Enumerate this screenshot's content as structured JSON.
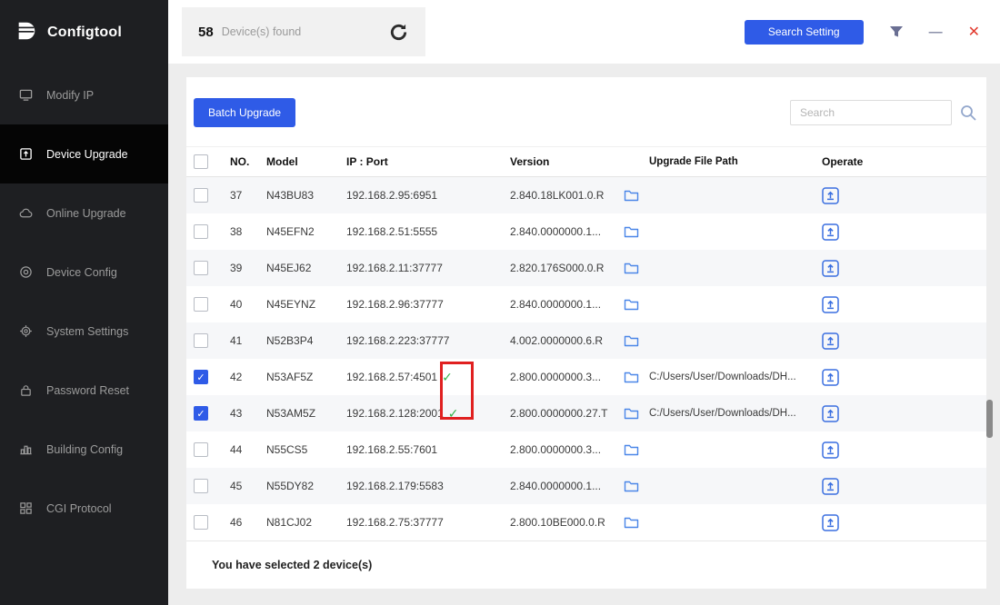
{
  "app": {
    "title": "Configtool"
  },
  "colors": {
    "accent_blue": "#2f5be7",
    "green_check": "#33b54a",
    "annotation_red": "#e02020",
    "close_red": "#e23a2e",
    "sidebar_bg": "#1e1f22"
  },
  "sidebar": {
    "items": [
      {
        "id": "modify-ip",
        "label": "Modify IP",
        "active": false
      },
      {
        "id": "device-upgrade",
        "label": "Device Upgrade",
        "active": true
      },
      {
        "id": "online-upgrade",
        "label": "Online Upgrade",
        "active": false
      },
      {
        "id": "device-config",
        "label": "Device Config",
        "active": false
      },
      {
        "id": "system-settings",
        "label": "System Settings",
        "active": false
      },
      {
        "id": "password-reset",
        "label": "Password Reset",
        "active": false
      },
      {
        "id": "building-config",
        "label": "Building Config",
        "active": false
      },
      {
        "id": "cgi-protocol",
        "label": "CGI Protocol",
        "active": false
      }
    ]
  },
  "header": {
    "device_count": "58",
    "device_count_label": "Device(s) found",
    "search_setting_label": "Search Setting"
  },
  "toolbar": {
    "batch_upgrade_label": "Batch Upgrade",
    "search_placeholder": "Search"
  },
  "table": {
    "columns": [
      "NO.",
      "Model",
      "IP : Port",
      "Version",
      "Upgrade File Path",
      "Operate"
    ],
    "rows": [
      {
        "no": "37",
        "model": "N43BU83",
        "ip_port": "192.168.2.95:6951",
        "version": "2.840.18LK001.0.R",
        "file_path": "",
        "checked": false,
        "verified": false
      },
      {
        "no": "38",
        "model": "N45EFN2",
        "ip_port": "192.168.2.51:5555",
        "version": "2.840.0000000.1...",
        "file_path": "",
        "checked": false,
        "verified": false
      },
      {
        "no": "39",
        "model": "N45EJ62",
        "ip_port": "192.168.2.11:37777",
        "version": "2.820.176S000.0.R",
        "file_path": "",
        "checked": false,
        "verified": false
      },
      {
        "no": "40",
        "model": "N45EYNZ",
        "ip_port": "192.168.2.96:37777",
        "version": "2.840.0000000.1...",
        "file_path": "",
        "checked": false,
        "verified": false
      },
      {
        "no": "41",
        "model": "N52B3P4",
        "ip_port": "192.168.2.223:37777",
        "version": "4.002.0000000.6.R",
        "file_path": "",
        "checked": false,
        "verified": false
      },
      {
        "no": "42",
        "model": "N53AF5Z",
        "ip_port": "192.168.2.57:4501",
        "version": "2.800.0000000.3...",
        "file_path": "C:/Users/User/Downloads/DH...",
        "checked": true,
        "verified": true
      },
      {
        "no": "43",
        "model": "N53AM5Z",
        "ip_port": "192.168.2.128:2001",
        "version": "2.800.0000000.27.T",
        "file_path": "C:/Users/User/Downloads/DH...",
        "checked": true,
        "verified": true
      },
      {
        "no": "44",
        "model": "N55CS5",
        "ip_port": "192.168.2.55:7601",
        "version": "2.800.0000000.3...",
        "file_path": "",
        "checked": false,
        "verified": false
      },
      {
        "no": "45",
        "model": "N55DY82",
        "ip_port": "192.168.2.179:5583",
        "version": "2.840.0000000.1...",
        "file_path": "",
        "checked": false,
        "verified": false
      },
      {
        "no": "46",
        "model": "N81CJ02",
        "ip_port": "192.168.2.75:37777",
        "version": "2.800.10BE000.0.R",
        "file_path": "",
        "checked": false,
        "verified": false
      }
    ]
  },
  "footer": {
    "selected_text": "You have selected 2  device(s)"
  }
}
